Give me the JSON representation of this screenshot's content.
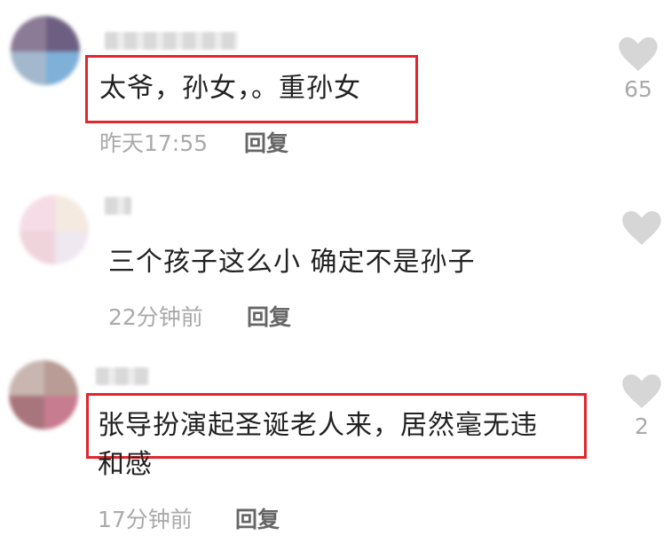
{
  "comments": [
    {
      "text_line1": "太爷，孙女，。重孙女",
      "text_line2": "",
      "time": "昨天17:55",
      "reply_label": "回复",
      "likes": "65",
      "highlighted": true
    },
    {
      "text_line1": "三个孩子这么小 确定不是孙子",
      "text_line2": "",
      "time": "22分钟前",
      "reply_label": "回复",
      "likes": "",
      "highlighted": false
    },
    {
      "text_line1": "张导扮演起圣诞老人来，居然毫无违",
      "text_line2": "和感",
      "time": "17分钟前",
      "reply_label": "回复",
      "likes": "2",
      "highlighted": true
    }
  ],
  "colors": {
    "highlight_border": "#e1262d",
    "like_icon": "#d6d6d6",
    "muted_text": "#aaaaaa"
  },
  "icons": {
    "like": "heart-icon"
  }
}
